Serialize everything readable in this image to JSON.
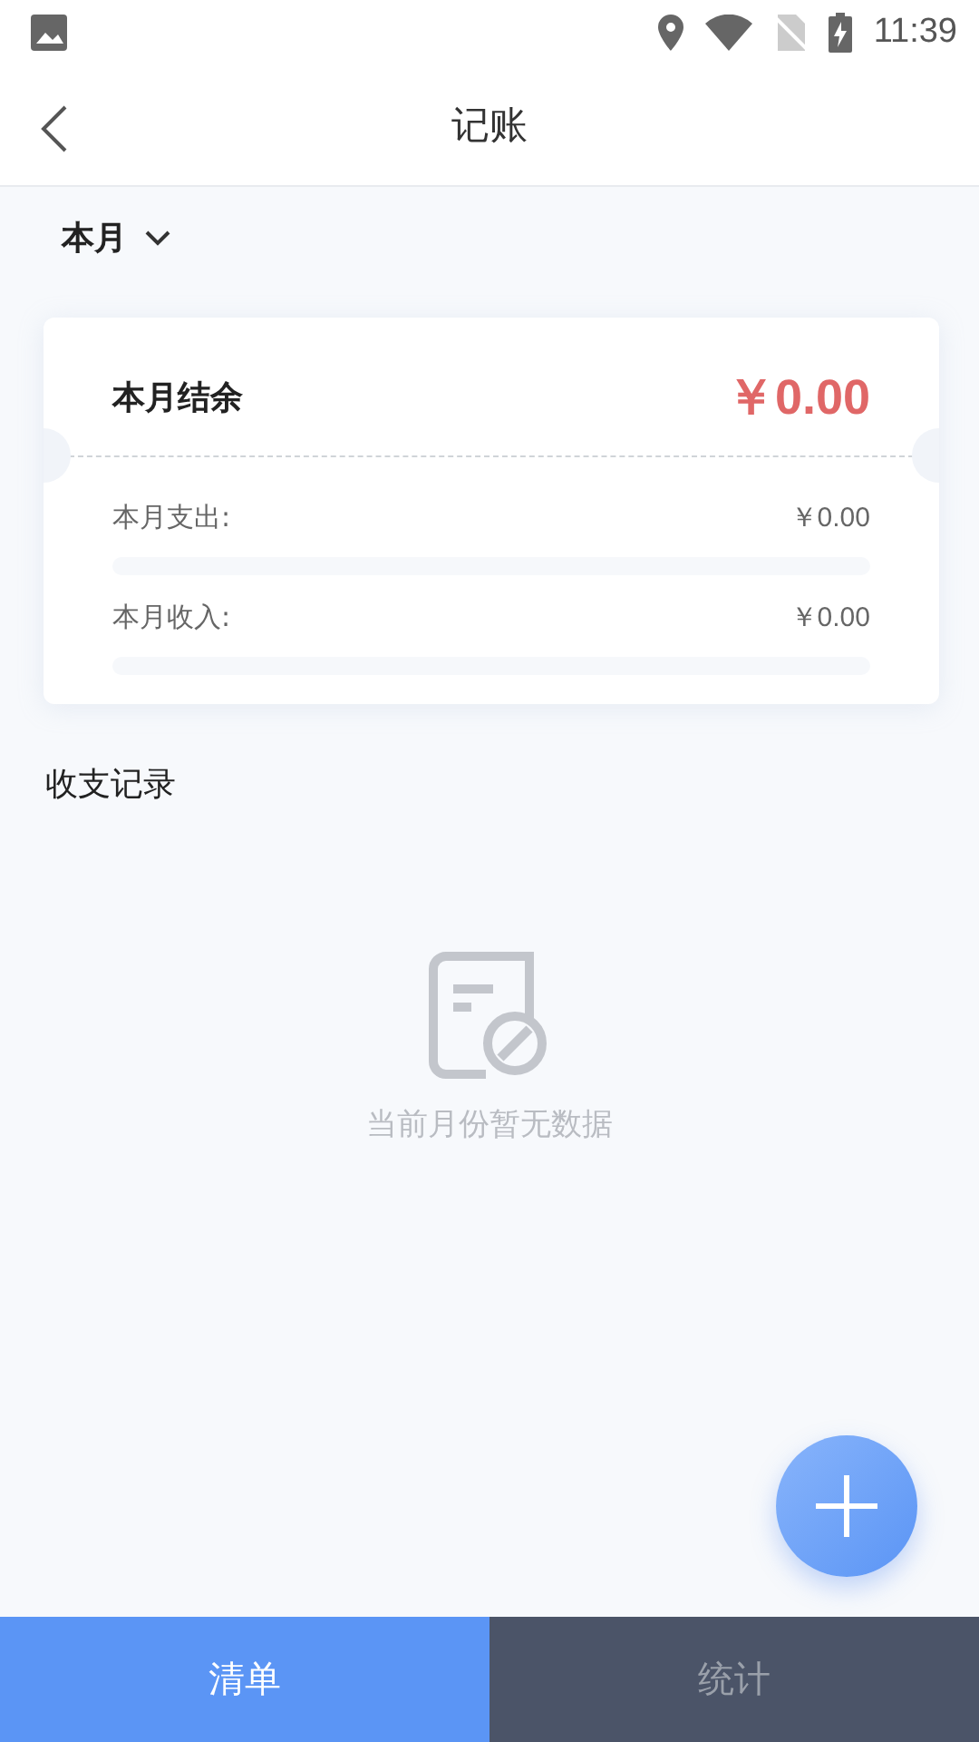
{
  "status_bar": {
    "time": "11:39"
  },
  "header": {
    "title": "记账"
  },
  "period": {
    "label": "本月"
  },
  "summary": {
    "balance_label": "本月结余",
    "balance": "￥0.00",
    "rows": [
      {
        "label": "本月支出:",
        "amount": "￥0.00"
      },
      {
        "label": "本月收入:",
        "amount": "￥0.00"
      }
    ]
  },
  "records": {
    "title": "收支记录",
    "empty_text": "当前月份暂无数据"
  },
  "tabs": [
    {
      "label": "清单",
      "selected": true
    },
    {
      "label": "统计",
      "selected": false
    }
  ]
}
